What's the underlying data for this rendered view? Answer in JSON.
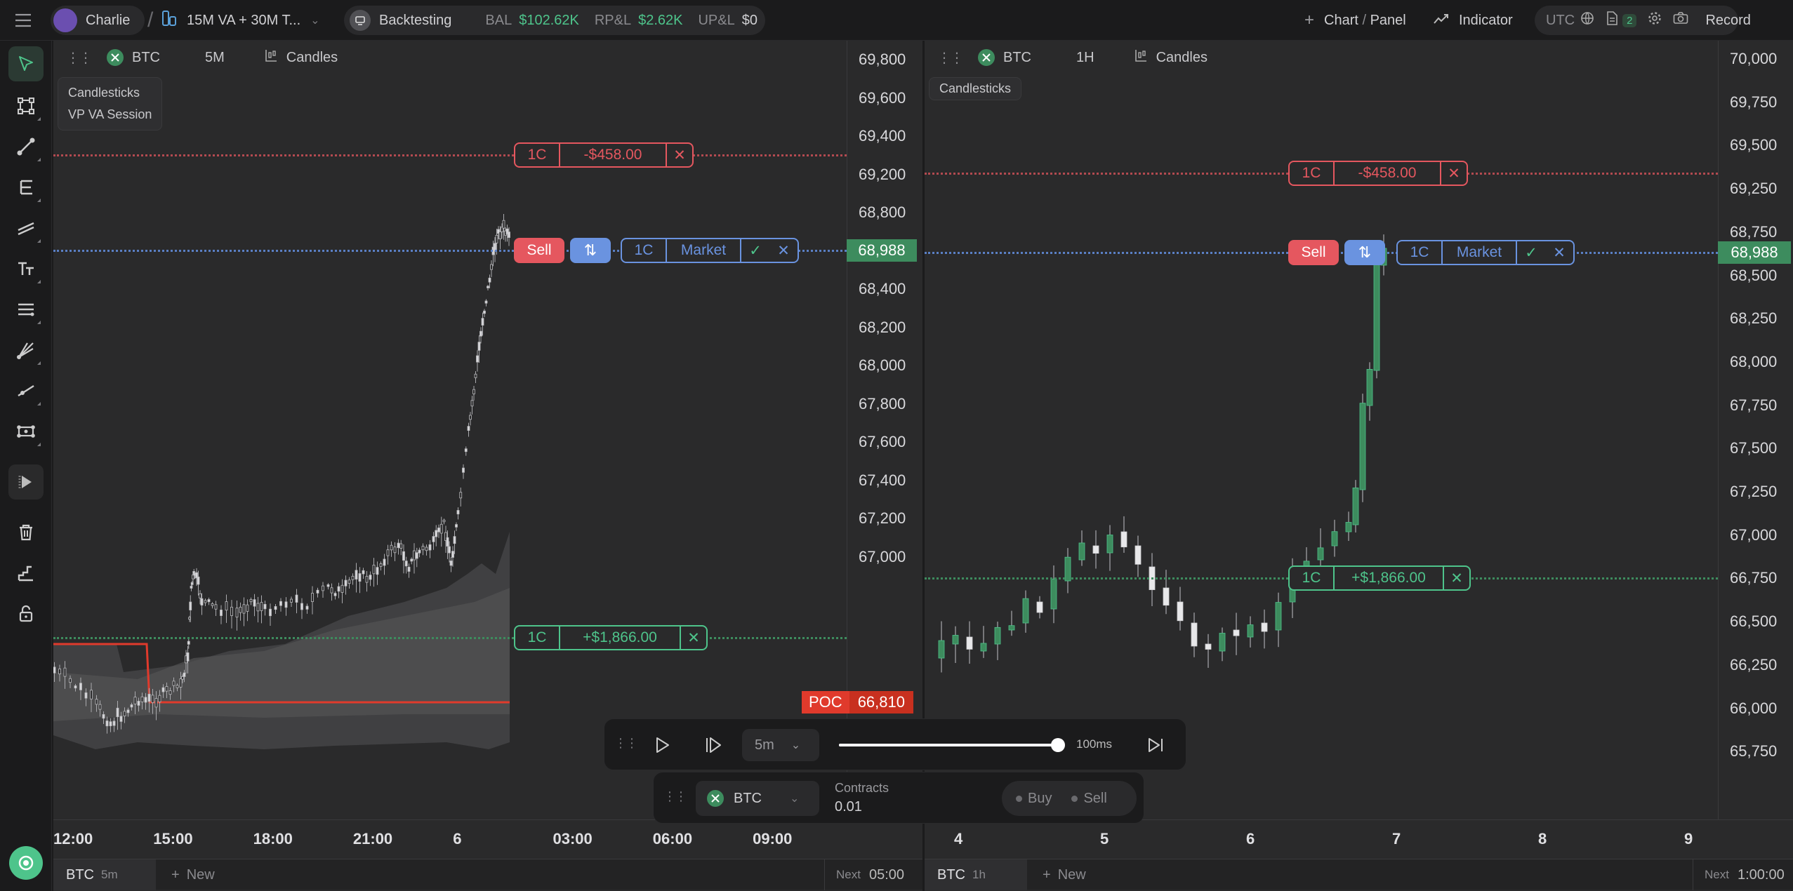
{
  "topbar": {
    "user": "Charlie",
    "separator": "/",
    "layout_name": "15M VA + 30M T...",
    "mode": "Backtesting",
    "bal_label": "BAL",
    "bal_value": "$102.62K",
    "rpl_label": "RP&L",
    "rpl_value": "$2.62K",
    "upl_label": "UP&L",
    "upl_value": "$0",
    "chart_panel_a": "Chart",
    "chart_panel_sep": " / ",
    "chart_panel_b": "Panel",
    "indicator": "Indicator",
    "timezone": "UTC",
    "notes_count": "2",
    "record": "Record"
  },
  "colors": {
    "green": "#4ec48b",
    "red": "#e5575f",
    "blue": "#6a93e0",
    "accent_green_box": "#3d8c5e",
    "poc": "#e03a2c"
  },
  "left_toolbar": [
    "cursor-icon",
    "selection-icon",
    "trendline-icon",
    "fibonacci-icon",
    "parallel-lines-icon",
    "text-icon",
    "multi-line-icon",
    "pitchfork-icon",
    "ray-icon",
    "pattern-icon",
    "replay-icon",
    "trash-icon",
    "ruler-icon",
    "lock-icon",
    "logo-icon"
  ],
  "left_panel": {
    "symbol": "BTC",
    "timeframe": "5M",
    "chart_type": "Candles",
    "legend": [
      "Candlesticks",
      "VP VA Session"
    ],
    "y_ticks": [
      "69,800",
      "69,600",
      "69,400",
      "69,200",
      "68,988",
      "68,800",
      "68,600",
      "68,400",
      "68,200",
      "68,000",
      "67,800",
      "67,600",
      "67,400",
      "67,200",
      "67,000"
    ],
    "x_ticks": [
      "12:00",
      "15:00",
      "18:00",
      "21:00",
      "6",
      "03:00",
      "06:00",
      "09:00"
    ],
    "current_price": "68,988",
    "poc_label": "POC",
    "poc_price": "66,810",
    "loss_order": {
      "qty": "1C",
      "pnl": "-$458.00",
      "close": "✕"
    },
    "active_order": {
      "side": "Sell",
      "swap": "⇅",
      "qty": "1C",
      "type": "Market",
      "confirm": "✓",
      "close": "✕"
    },
    "profit_order": {
      "qty": "1C",
      "pnl": "+$1,866.00",
      "close": "✕"
    },
    "tab_symbol": "BTC",
    "tab_tf": "5m",
    "new_tab": "New",
    "next_label": "Next",
    "next_time": "05:00"
  },
  "right_panel": {
    "symbol": "BTC",
    "timeframe": "1H",
    "chart_type": "Candles",
    "legend": [
      "Candlesticks"
    ],
    "y_ticks": [
      "70,000",
      "69,750",
      "69,500",
      "69,250",
      "68,988",
      "68,750",
      "68,500",
      "68,250",
      "68,000",
      "67,750",
      "67,500",
      "67,250",
      "67,000",
      "66,750",
      "66,500",
      "66,250",
      "66,000",
      "65,750"
    ],
    "x_ticks": [
      "4",
      "5",
      "6",
      "7",
      "8",
      "9"
    ],
    "current_price": "68,988",
    "loss_order": {
      "qty": "1C",
      "pnl": "-$458.00",
      "close": "✕"
    },
    "active_order": {
      "side": "Sell",
      "swap": "⇅",
      "qty": "1C",
      "type": "Market",
      "confirm": "✓",
      "close": "✕"
    },
    "profit_order": {
      "qty": "1C",
      "pnl": "+$1,866.00",
      "close": "✕"
    },
    "tab_symbol": "BTC",
    "tab_tf": "1h",
    "new_tab": "New",
    "next_label": "Next",
    "next_time": "1:00:00"
  },
  "playback": {
    "interval": "5m",
    "speed": "100ms",
    "slider_fraction": 0.98
  },
  "trade_panel": {
    "symbol": "BTC",
    "contracts_label": "Contracts",
    "contracts_value": "0.01",
    "buy": "Buy",
    "sell": "Sell"
  }
}
